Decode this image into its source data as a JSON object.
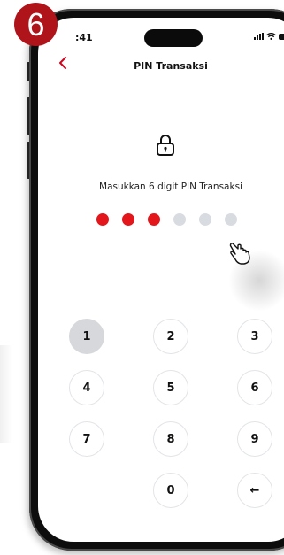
{
  "step_badge": "6",
  "status_bar": {
    "time": ":41",
    "icons": [
      "signal-icon",
      "wifi-icon",
      "battery-icon"
    ]
  },
  "header": {
    "back_icon": "chevron-left-icon",
    "title": "PIN Transaksi"
  },
  "lock_icon": "lock-icon",
  "instruction": "Masukkan 6 digit PIN Transaksi",
  "pin": {
    "length": 6,
    "filled": 3,
    "filled_color": "#e3161c",
    "empty_color": "#d8dbe0"
  },
  "pointer_icon": "hand-pointer-icon",
  "keypad": {
    "keys": [
      "1",
      "2",
      "3",
      "4",
      "5",
      "6",
      "7",
      "8",
      "9",
      "",
      "0",
      "←"
    ],
    "pressed_key": "1",
    "backspace_icon": "arrow-left-icon"
  },
  "colors": {
    "accent": "#d0021b",
    "badge": "#b0141b"
  }
}
